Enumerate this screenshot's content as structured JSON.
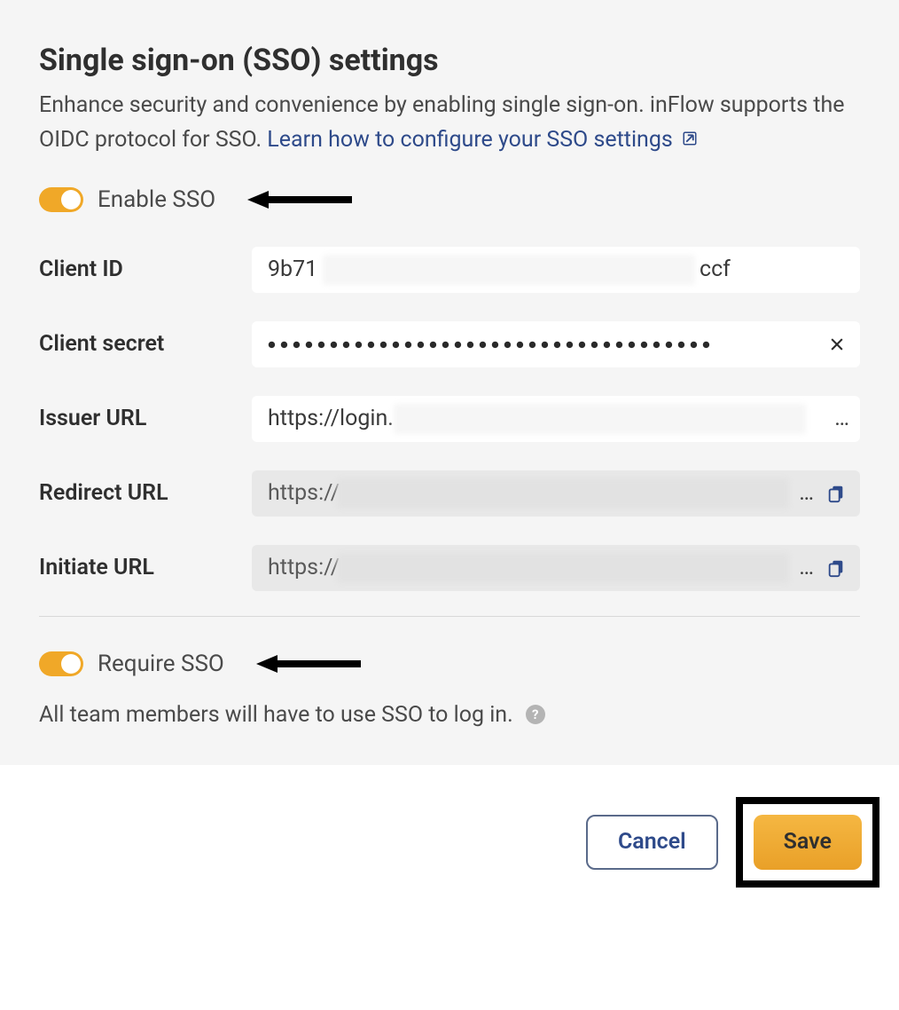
{
  "title": "Single sign-on (SSO) settings",
  "description_prefix": "Enhance security and convenience by enabling single sign-on. inFlow supports the OIDC protocol for SSO. ",
  "link_text": "Learn how to configure your SSO settings",
  "enable_toggle": {
    "label": "Enable SSO",
    "checked": true
  },
  "fields": {
    "client_id": {
      "label": "Client ID",
      "prefix": "9b71",
      "suffix": "ccf"
    },
    "client_secret": {
      "label": "Client secret",
      "masked": "●●●●●●●●●●●●●●●●●●●●●●●●●●●●●●●●●●●●"
    },
    "issuer_url": {
      "label": "Issuer URL",
      "prefix": "https://login."
    },
    "redirect_url": {
      "label": "Redirect URL",
      "prefix": "https://"
    },
    "initiate_url": {
      "label": "Initiate URL",
      "prefix": "https://"
    }
  },
  "require_toggle": {
    "label": "Require SSO",
    "checked": true,
    "help_text": "All team members will have to use SSO to log in."
  },
  "buttons": {
    "cancel": "Cancel",
    "save": "Save"
  }
}
